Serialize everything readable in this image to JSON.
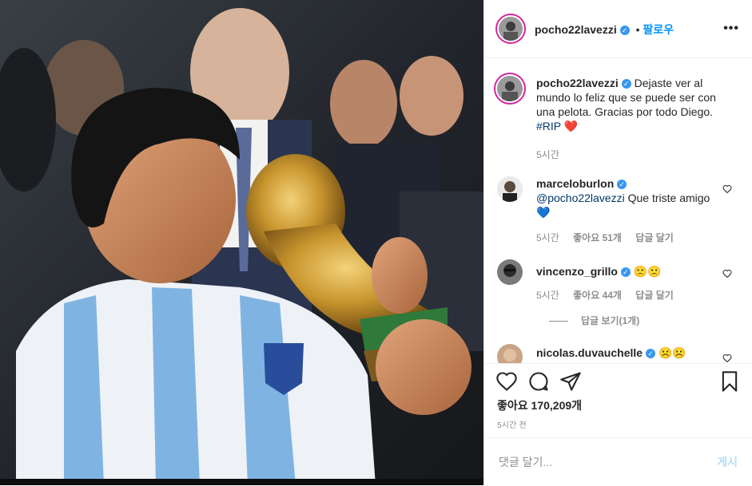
{
  "header": {
    "username": "pocho22lavezzi",
    "separator": "•",
    "follow_label": "팔로우",
    "more_label": "•••"
  },
  "caption": {
    "username": "pocho22lavezzi",
    "text": "Dejaste ver al mundo lo feliz que se puede ser con una pelota. Gracias por todo Diego.",
    "hashtag": "#RIP",
    "emoji": "❤️",
    "time": "5시간"
  },
  "comments": [
    {
      "username": "marceloburlon",
      "mention": "@pocho22lavezzi",
      "text": "Que triste amigo",
      "emoji": "💙",
      "time": "5시간",
      "likes": "좋아요 51개",
      "reply_label": "답글 달기"
    },
    {
      "username": "vincenzo_grillo",
      "text": "",
      "emoji": "🙁🙁",
      "time": "5시간",
      "likes": "좋아요 44개",
      "reply_label": "답글 달기",
      "view_replies": "답글 보기(1개)"
    },
    {
      "username": "nicolas.duvauchelle",
      "text": "",
      "emoji": "☹️☹️"
    }
  ],
  "actions": {
    "likes_text": "좋아요 170,209개",
    "time_ago": "5시간 전"
  },
  "composer": {
    "placeholder": "댓글 달기...",
    "post_label": "게시"
  },
  "colors": {
    "accent": "#0095f6",
    "verified": "#3897f0",
    "muted": "#8e8e8e",
    "heart_red": "#ed4956"
  }
}
